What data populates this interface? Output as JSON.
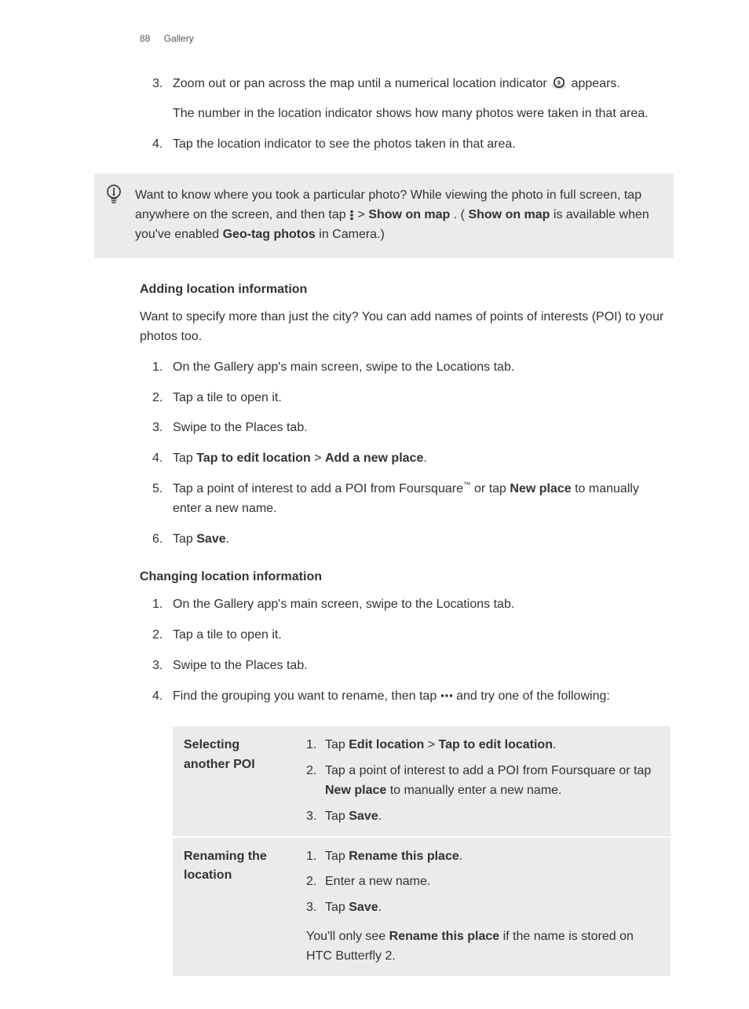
{
  "header": {
    "page_num": "88",
    "section": "Gallery"
  },
  "top_steps": {
    "s3_a": "Zoom out or pan across the map until a numerical location indicator ",
    "s3_b": "appears.",
    "s3_sub": "The number in the location indicator shows how many photos were taken in that area.",
    "s4": "Tap the location indicator to see the photos taken in that area."
  },
  "tip": {
    "a": "Want to know where you took a particular photo? While viewing the photo in full screen, tap anywhere on the screen, and then tap ",
    "b": " > ",
    "show_on_map": "Show on map",
    "c": ". (",
    "d": " is available when you've enabled ",
    "geo_tag": "Geo-tag photos",
    "e": " in Camera.)"
  },
  "adding": {
    "title": "Adding location information",
    "intro": "Want to specify more than just the city? You can add names of points of interests (POI) to your photos too.",
    "s1": "On the Gallery app's main screen, swipe to the Locations tab.",
    "s2": "Tap a tile to open it.",
    "s3": "Swipe to the Places tab.",
    "s4_pre": "Tap ",
    "s4_b1": "Tap to edit location",
    "s4_gt": " > ",
    "s4_b2": "Add a new place",
    "s4_post": ".",
    "s5_a": "Tap a point of interest to add a POI from Foursquare",
    "s5_tm": "™",
    "s5_b": " or tap ",
    "s5_np": "New place",
    "s5_c": " to manually enter a new name.",
    "s6_pre": "Tap ",
    "s6_b": "Save",
    "s6_post": "."
  },
  "changing": {
    "title": "Changing location information",
    "s1": "On the Gallery app's main screen, swipe to the Locations tab.",
    "s2": "Tap a tile to open it.",
    "s3": "Swipe to the Places tab.",
    "s4_a": "Find the grouping you want to rename, then tap ",
    "s4_b": " and try one of the following:"
  },
  "table": {
    "r1_left": "Selecting another POI",
    "r1_1_pre": "Tap ",
    "r1_1_b1": "Edit location",
    "r1_1_gt": " > ",
    "r1_1_b2": "Tap to edit location",
    "r1_1_post": ".",
    "r1_2_a": "Tap a point of interest to add a POI from Foursquare or tap ",
    "r1_2_np": "New place",
    "r1_2_b": " to manually enter a new name.",
    "r1_3_pre": "Tap ",
    "r1_3_b": "Save",
    "r1_3_post": ".",
    "r2_left": "Renaming the location",
    "r2_1_pre": "Tap ",
    "r2_1_b": "Rename this place",
    "r2_1_post": ".",
    "r2_2": "Enter a new name.",
    "r2_3_pre": "Tap ",
    "r2_3_b": "Save",
    "r2_3_post": ".",
    "r2_note_a": "You'll only see ",
    "r2_note_b": "Rename this place",
    "r2_note_c": " if the name is stored on HTC Butterfly 2."
  }
}
